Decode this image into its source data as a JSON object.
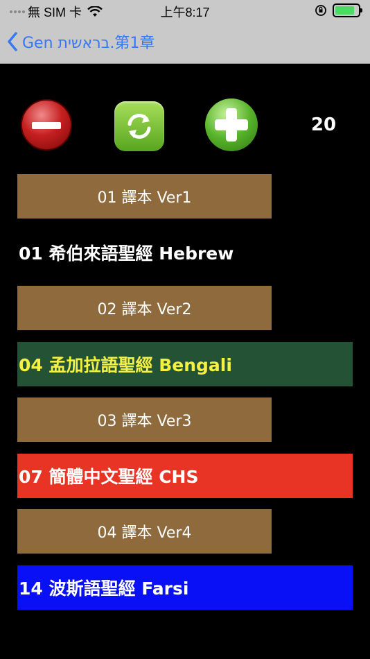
{
  "status_bar": {
    "carrier": "無 SIM 卡",
    "time": "上午8:17",
    "battery_level": 0.85,
    "colors": {
      "battery": "#4cd964"
    }
  },
  "nav": {
    "back_label": "Gen בראשית.第1章",
    "color": "#3478f6"
  },
  "toolbar": {
    "remove_icon": "remove-icon",
    "refresh_icon": "refresh-icon",
    "add_icon": "add-icon",
    "count": "20"
  },
  "rows": [
    {
      "kind": "version",
      "label": "01 譯本 Ver1",
      "bg": "#8e6a3d",
      "fg": "#ffffff"
    },
    {
      "kind": "bible",
      "label": "01 希伯來語聖經 Hebrew",
      "bg": "#000000",
      "fg": "#ffffff"
    },
    {
      "kind": "version",
      "label": "02 譯本 Ver2",
      "bg": "#8e6a3d",
      "fg": "#ffffff"
    },
    {
      "kind": "bible",
      "label": "04 孟加拉語聖經 Bengali",
      "bg": "#245234",
      "fg": "#f5f044"
    },
    {
      "kind": "version",
      "label": "03 譯本 Ver3",
      "bg": "#8e6a3d",
      "fg": "#ffffff"
    },
    {
      "kind": "bible",
      "label": "07 簡體中文聖經 CHS",
      "bg": "#e83424",
      "fg": "#ffffff"
    },
    {
      "kind": "version",
      "label": "04 譯本 Ver4",
      "bg": "#8e6a3d",
      "fg": "#ffffff"
    },
    {
      "kind": "bible",
      "label": "14 波斯語聖經 Farsi",
      "bg": "#0a10f5",
      "fg": "#ffffff"
    }
  ]
}
